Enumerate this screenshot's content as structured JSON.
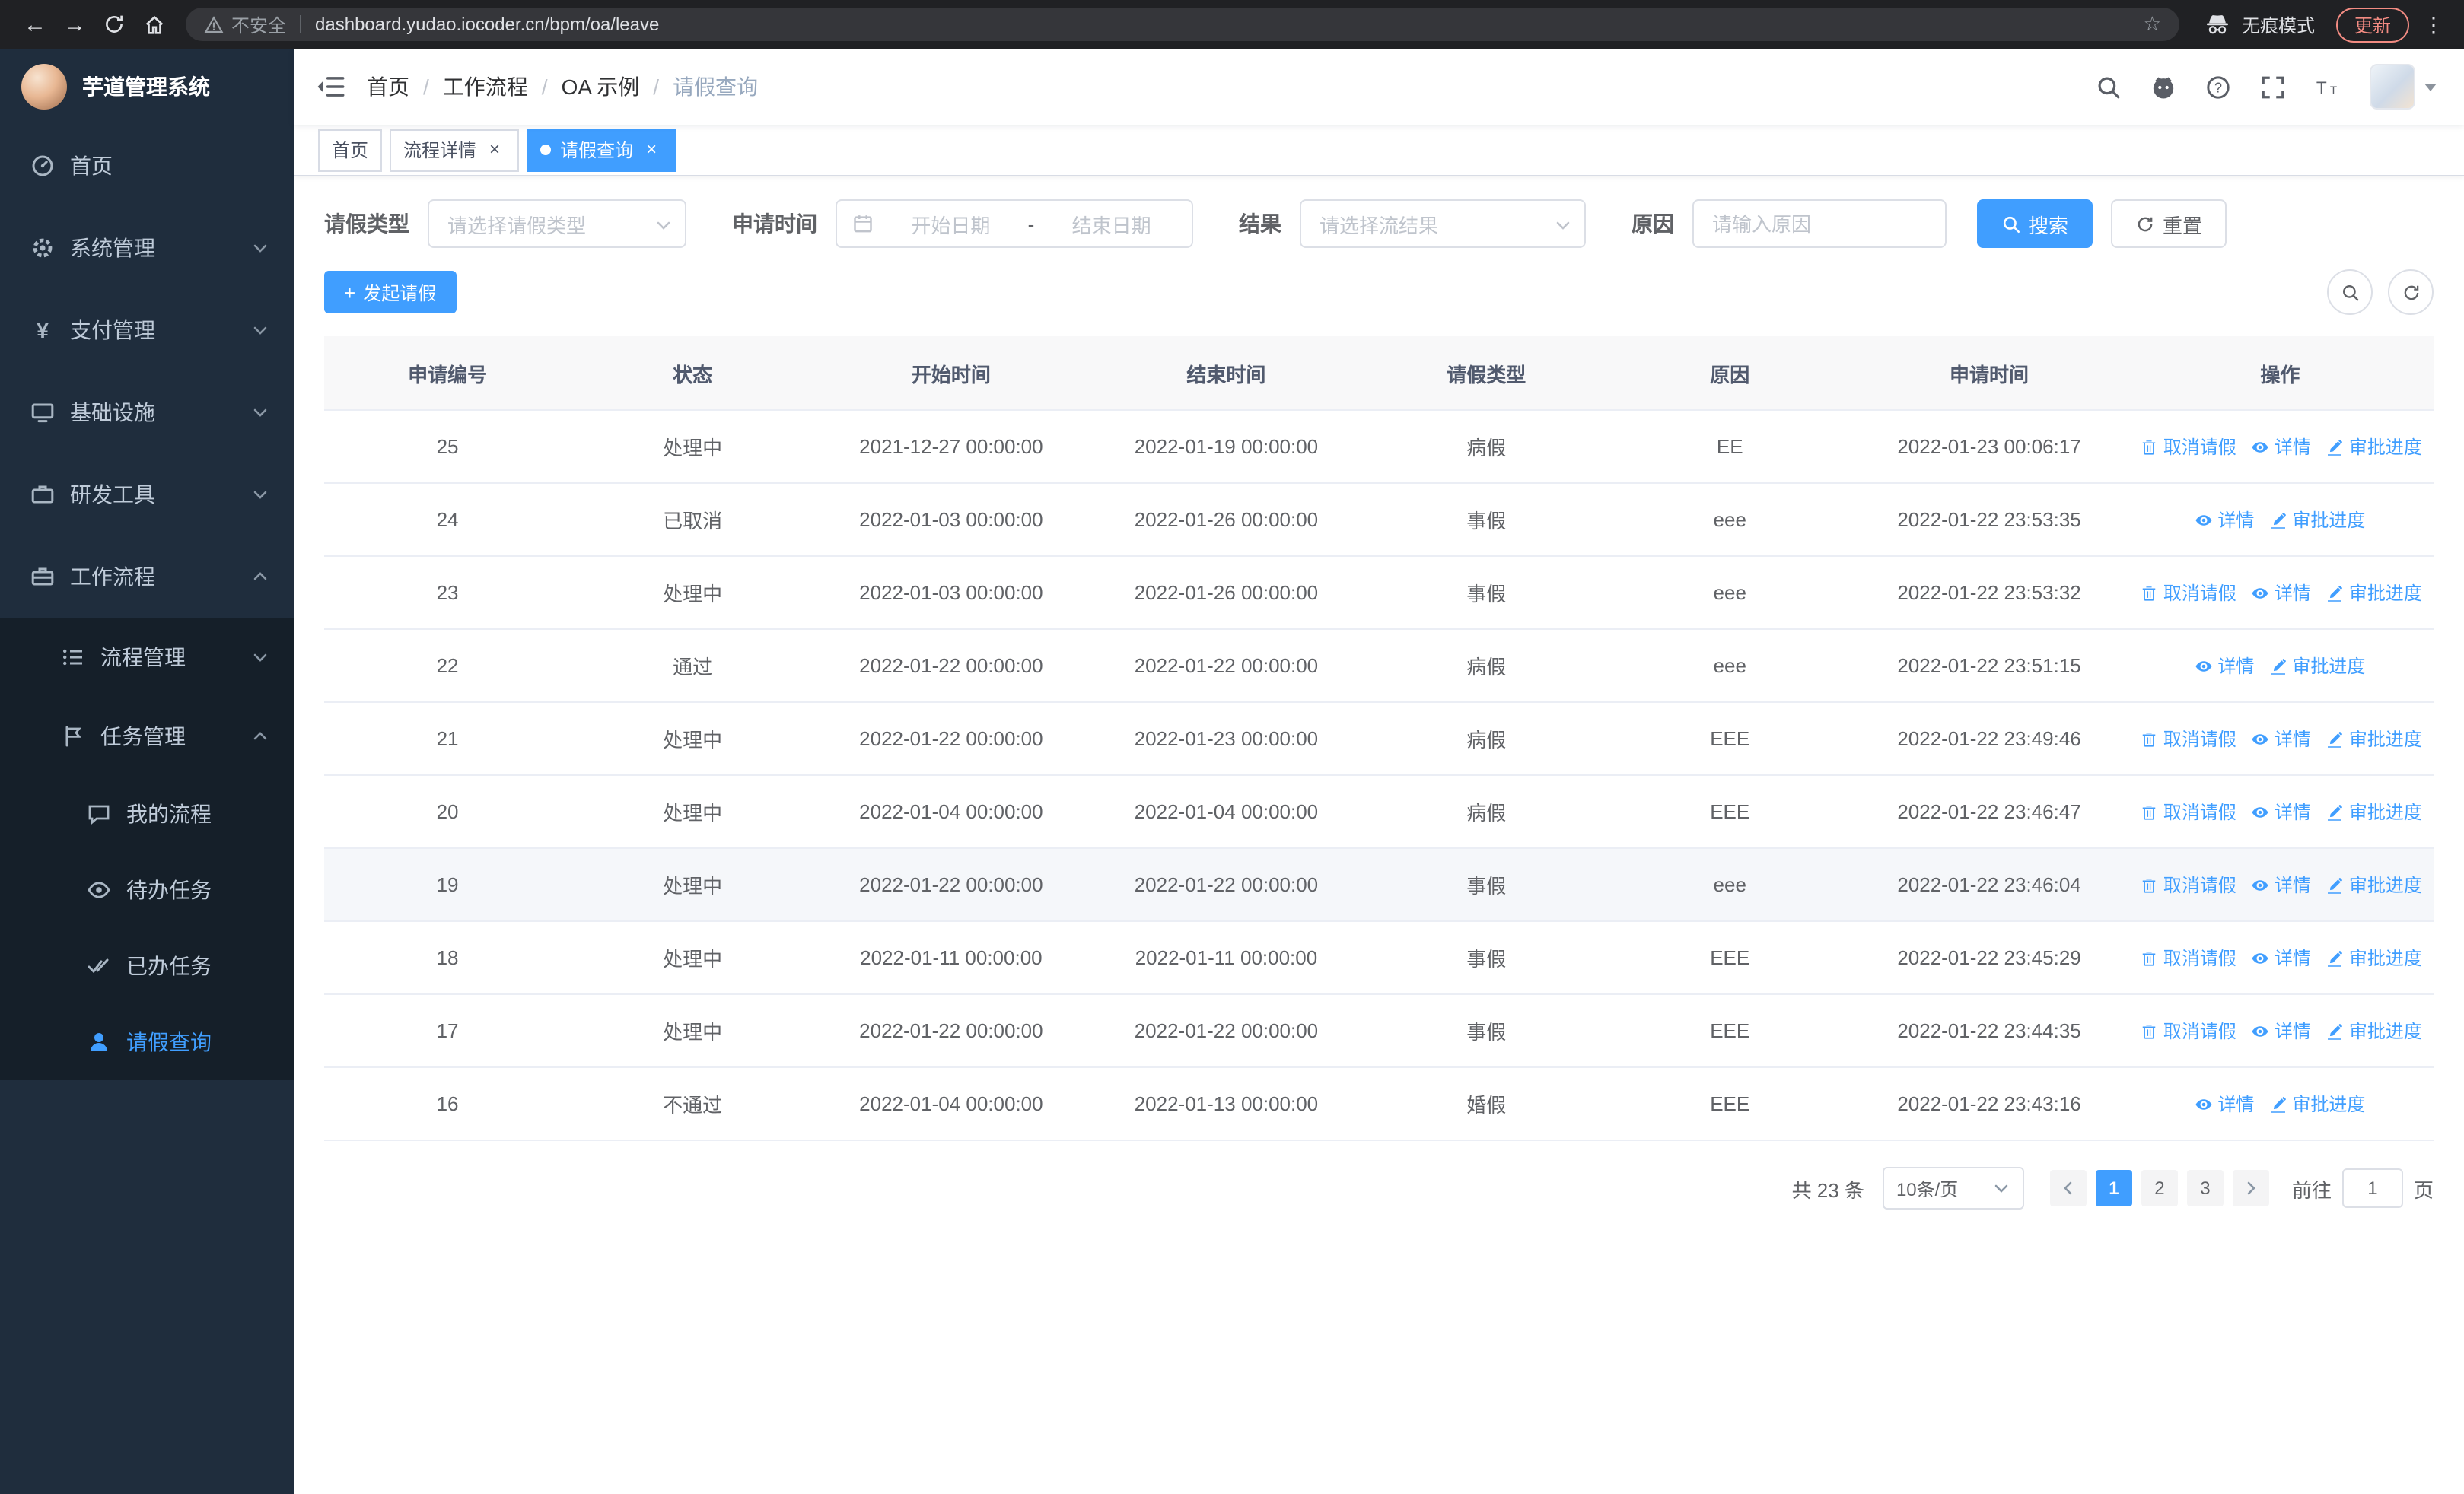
{
  "browser": {
    "security_warning": "不安全",
    "url": "dashboard.yudao.iocoder.cn/bpm/oa/leave",
    "incognito_label": "无痕模式",
    "update_label": "更新"
  },
  "sidebar": {
    "logo_title": "芋道管理系统",
    "items": [
      {
        "label": "首页",
        "icon": "dashboard-icon",
        "expandable": false
      },
      {
        "label": "系统管理",
        "icon": "gear-icon",
        "expandable": true
      },
      {
        "label": "支付管理",
        "icon": "yen-icon",
        "expandable": true
      },
      {
        "label": "基础设施",
        "icon": "monitor-icon",
        "expandable": true
      },
      {
        "label": "研发工具",
        "icon": "toolbox-icon",
        "expandable": true
      },
      {
        "label": "工作流程",
        "icon": "briefcase-icon",
        "expandable": true,
        "expanded": true
      }
    ],
    "process_group": {
      "label": "流程管理",
      "icon": "list-tree-icon",
      "expanded": false
    },
    "task_group": {
      "label": "任务管理",
      "icon": "flag-icon",
      "expanded": true
    },
    "task_items": [
      {
        "label": "我的流程",
        "icon": "chat-icon",
        "active": false
      },
      {
        "label": "待办任务",
        "icon": "eye-icon",
        "active": false
      },
      {
        "label": "已办任务",
        "icon": "double-check-icon",
        "active": false
      },
      {
        "label": "请假查询",
        "icon": "user-icon",
        "active": true
      }
    ]
  },
  "header": {
    "breadcrumb": [
      "首页",
      "工作流程",
      "OA 示例",
      "请假查询"
    ]
  },
  "tabs": [
    {
      "label": "首页",
      "closable": false,
      "active": false
    },
    {
      "label": "流程详情",
      "closable": true,
      "active": false
    },
    {
      "label": "请假查询",
      "closable": true,
      "active": true
    }
  ],
  "filters": {
    "leave_type_label": "请假类型",
    "leave_type_placeholder": "请选择请假类型",
    "apply_time_label": "申请时间",
    "start_date_placeholder": "开始日期",
    "range_separator": "-",
    "end_date_placeholder": "结束日期",
    "result_label": "结果",
    "result_placeholder": "请选择流结果",
    "reason_label": "原因",
    "reason_placeholder": "请输入原因",
    "search_button": "搜索",
    "reset_button": "重置"
  },
  "toolbar": {
    "create_button": "发起请假"
  },
  "table": {
    "columns": [
      "申请编号",
      "状态",
      "开始时间",
      "结束时间",
      "请假类型",
      "原因",
      "申请时间",
      "操作"
    ],
    "action_labels": {
      "cancel": "取消请假",
      "detail": "详情",
      "progress": "审批进度"
    },
    "action_icons": {
      "cancel": "delete-icon",
      "detail": "view-icon",
      "progress": "edit-icon"
    },
    "rows": [
      {
        "id": "25",
        "status": "处理中",
        "start": "2021-12-27 00:00:00",
        "end": "2022-01-19 00:00:00",
        "type": "病假",
        "reason": "EE",
        "applyTime": "2022-01-23 00:06:17",
        "cancelable": true,
        "highlighted": false
      },
      {
        "id": "24",
        "status": "已取消",
        "start": "2022-01-03 00:00:00",
        "end": "2022-01-26 00:00:00",
        "type": "事假",
        "reason": "eee",
        "applyTime": "2022-01-22 23:53:35",
        "cancelable": false,
        "highlighted": false
      },
      {
        "id": "23",
        "status": "处理中",
        "start": "2022-01-03 00:00:00",
        "end": "2022-01-26 00:00:00",
        "type": "事假",
        "reason": "eee",
        "applyTime": "2022-01-22 23:53:32",
        "cancelable": true,
        "highlighted": false
      },
      {
        "id": "22",
        "status": "通过",
        "start": "2022-01-22 00:00:00",
        "end": "2022-01-22 00:00:00",
        "type": "病假",
        "reason": "eee",
        "applyTime": "2022-01-22 23:51:15",
        "cancelable": false,
        "highlighted": false
      },
      {
        "id": "21",
        "status": "处理中",
        "start": "2022-01-22 00:00:00",
        "end": "2022-01-23 00:00:00",
        "type": "病假",
        "reason": "EEE",
        "applyTime": "2022-01-22 23:49:46",
        "cancelable": true,
        "highlighted": false
      },
      {
        "id": "20",
        "status": "处理中",
        "start": "2022-01-04 00:00:00",
        "end": "2022-01-04 00:00:00",
        "type": "病假",
        "reason": "EEE",
        "applyTime": "2022-01-22 23:46:47",
        "cancelable": true,
        "highlighted": false
      },
      {
        "id": "19",
        "status": "处理中",
        "start": "2022-01-22 00:00:00",
        "end": "2022-01-22 00:00:00",
        "type": "事假",
        "reason": "eee",
        "applyTime": "2022-01-22 23:46:04",
        "cancelable": true,
        "highlighted": true
      },
      {
        "id": "18",
        "status": "处理中",
        "start": "2022-01-11 00:00:00",
        "end": "2022-01-11 00:00:00",
        "type": "事假",
        "reason": "EEE",
        "applyTime": "2022-01-22 23:45:29",
        "cancelable": true,
        "highlighted": false
      },
      {
        "id": "17",
        "status": "处理中",
        "start": "2022-01-22 00:00:00",
        "end": "2022-01-22 00:00:00",
        "type": "事假",
        "reason": "EEE",
        "applyTime": "2022-01-22 23:44:35",
        "cancelable": true,
        "highlighted": false
      },
      {
        "id": "16",
        "status": "不通过",
        "start": "2022-01-04 00:00:00",
        "end": "2022-01-13 00:00:00",
        "type": "婚假",
        "reason": "EEE",
        "applyTime": "2022-01-22 23:43:16",
        "cancelable": false,
        "highlighted": false
      }
    ]
  },
  "pagination": {
    "total_text": "共 23 条",
    "page_size": "10条/页",
    "pages": [
      "1",
      "2",
      "3"
    ],
    "active_page": "1",
    "goto_prefix": "前往",
    "goto_value": "1",
    "goto_suffix": "页"
  },
  "colors": {
    "accent": "#409eff",
    "sidebar_bg": "#1f2d3d",
    "sidebar_submenu_bg": "#151f29",
    "active_menu_text": "#409eff",
    "table_header_bg": "#f8f8f9",
    "table_border": "#ebeef5",
    "chrome_bg": "#202124",
    "addressbar_bg": "#35363a",
    "update_badge": "#f28b82",
    "breadcrumb_muted": "#97a8be"
  }
}
